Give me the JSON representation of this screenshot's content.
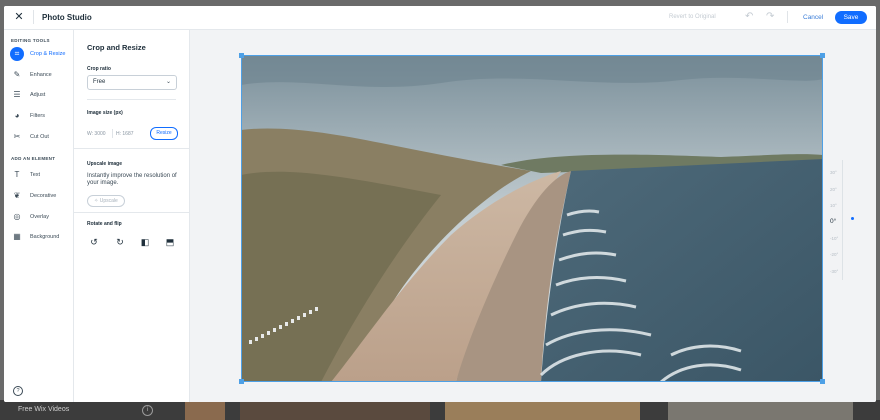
{
  "header": {
    "title": "Photo Studio",
    "revert_label": "Revert to Original",
    "cancel_label": "Cancel",
    "save_label": "Save"
  },
  "sidebar": {
    "editing_tools_label": "EDITING TOOLS",
    "add_element_label": "ADD AN ELEMENT",
    "editing_tools": [
      {
        "label": "Crop & Resize",
        "icon": "crop-icon",
        "active": true
      },
      {
        "label": "Enhance",
        "icon": "enhance-icon"
      },
      {
        "label": "Adjust",
        "icon": "sliders-icon"
      },
      {
        "label": "Filters",
        "icon": "filters-icon"
      },
      {
        "label": "Cut Out",
        "icon": "scissors-icon"
      }
    ],
    "elements": [
      {
        "label": "Text",
        "icon": "text-icon"
      },
      {
        "label": "Decorative",
        "icon": "decorative-icon"
      },
      {
        "label": "Overlay",
        "icon": "overlay-icon"
      },
      {
        "label": "Background",
        "icon": "background-icon"
      }
    ]
  },
  "panel": {
    "title": "Crop and Resize",
    "crop_ratio_label": "Crop ratio",
    "crop_ratio_value": "Free",
    "image_size_label": "Image size (px)",
    "width_text": "W: 3000",
    "height_text": "H: 1687",
    "resize_label": "Resize",
    "upscale_title": "Upscale image",
    "upscale_text": "Instantly improve the resolution of your image.",
    "upscale_button": "Upscale",
    "rotate_label": "Rotate and flip"
  },
  "ruler": {
    "ticks": [
      "30°",
      "20°",
      "10°",
      "0°",
      "-10°",
      "-20°",
      "-30°"
    ],
    "current": "0°"
  },
  "backdrop": {
    "label": "Free Wix Videos",
    "info_icon": "i"
  },
  "colors": {
    "accent": "#116dff",
    "crop_frame": "#4ea0e6"
  }
}
